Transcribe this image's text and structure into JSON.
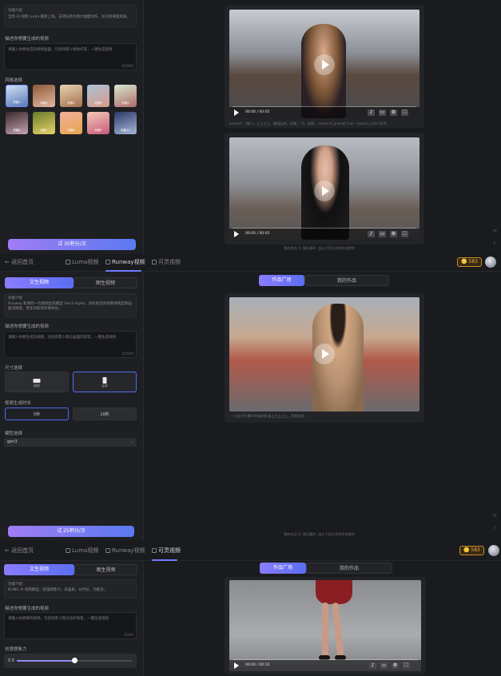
{
  "band1": {
    "intro_title": "功能介绍",
    "intro_text": "全新 AI 视频 Luma 最新上线，支持任意比例大幅面创作，标识效果超高质。",
    "prompt_label": "描述你想要生成的视频",
    "prompt_placeholder": "请输入你要生成的视频画面，包括场景人物动作等，一键生成视频",
    "prompt_count": "0/2000",
    "style_label": "风格选择",
    "style_thumbs": [
      "风格1",
      "风格2",
      "风格3",
      "风格4",
      "风格5",
      "风格6",
      "风格7",
      "风格8",
      "风格9",
      "风格10"
    ],
    "cta": "试 30积分/次",
    "video1_time": "00:00 / 00:05",
    "video1_caption": "prompt：「美人」之上之上，美国品质，风格，「3」风格：--expand_prompt true --aspect_ratio 16:9",
    "video2_time": "00:00 / 00:05",
    "footer": "我的作品 © 我们通AI",
    "footer2": "由以下官方合作伙伴提供"
  },
  "band2": {
    "back": "返回首页",
    "tab_luma": "Luma视频",
    "tab_runway": "Runway视频",
    "tab_kling": "可灵视频",
    "coins": "583",
    "seg_text": "文生视频",
    "seg_image": "图生视频",
    "intro_title": "功能介绍",
    "intro_text": "Runway 新闻的一代视频生成模型 Gen3 Alpha，具有极佳的视频保真度和画面流畅度，更多功能等你来体验。",
    "prompt_label": "描述你想要生成的视频",
    "prompt_placeholder": "请输入你要生成的视频，包括场景人物与画面内容等，一键生成视频",
    "prompt_count": "0/2000",
    "size_label": "尺寸选择",
    "size_options": [
      "横屏",
      "竖屏"
    ],
    "duration_label": "视频生成时长",
    "duration_options": [
      "5秒",
      "10秒"
    ],
    "model_label": "模型选择",
    "model_value": "gen3",
    "cta": "试 25积分/次",
    "gallery_tab": "作品广场",
    "my_tab": "我的作品",
    "video_caption": "一位女子在繁华的城市街道上之上之上，周围热闹",
    "footer": "我的作品 © 我们通AI",
    "footer2": "由以下官方合作伙伴提供"
  },
  "band3": {
    "back": "返回首页",
    "tab_luma": "Luma视频",
    "tab_runway": "Runway视频",
    "tab_kling": "可灵视频",
    "coins": "583",
    "seg_text": "文生视频",
    "seg_image": "图生视频",
    "intro_title": "功能介绍",
    "intro_text": "KLING AI 视频模型，超强想象力，高画质，长时长，功能多。",
    "prompt_label": "描述你想要生成的视频",
    "prompt_placeholder": "请输入你想要的视频，包括场景人物与动作情景，一键生成视频",
    "prompt_count": "0/500",
    "creativity_label": "创意想象力",
    "creativity_value": "0.5",
    "gallery_tab": "作品广场",
    "my_tab": "我的作品",
    "video_time": "00:00 / 00:10"
  }
}
